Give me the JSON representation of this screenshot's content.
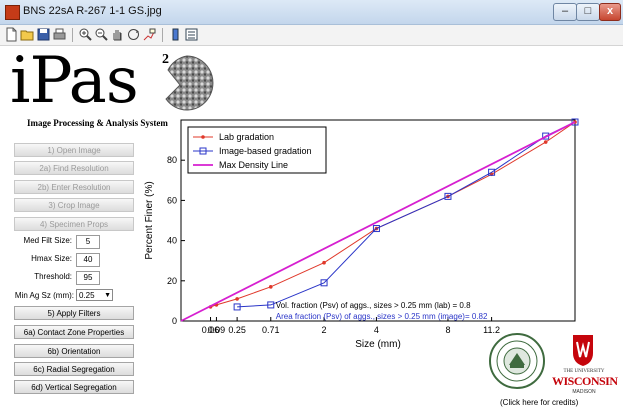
{
  "window": {
    "title": "BNS 22sA R-267 1-1 GS.jpg",
    "controls": {
      "minimize": "–",
      "maximize": "□",
      "close": "x"
    }
  },
  "toolbar": {
    "icons": [
      "new-file-icon",
      "open-folder-icon",
      "save-icon",
      "print-icon",
      "zoom-in-icon",
      "zoom-out-icon",
      "pan-hand-icon",
      "rotate-3d-icon",
      "data-cursor-icon",
      "colorbar-icon",
      "legend-icon"
    ]
  },
  "logo": {
    "text": "iPas",
    "superscript": "2"
  },
  "subtitle": "Image Processing & Analysis System",
  "steps": [
    {
      "label": "1) Open Image",
      "enabled": false
    },
    {
      "label": "2a) Find Resolution",
      "enabled": false
    },
    {
      "label": "2b) Enter Resolution",
      "enabled": false
    },
    {
      "label": "3) Crop Image",
      "enabled": false
    },
    {
      "label": "4) Specimen Props",
      "enabled": false
    }
  ],
  "params": {
    "med_filt_label": "Med Filt Size:",
    "med_filt_value": "5",
    "hmax_label": "Hmax Size:",
    "hmax_value": "40",
    "threshold_label": "Threshold:",
    "threshold_value": "95",
    "min_agg_label": "Min Ag Sz (mm):",
    "min_agg_value": "0.25"
  },
  "actions": {
    "apply_filters": "5) Apply Filters",
    "contact_zone": "6a) Contact Zone Properties",
    "orientation": "6b) Orientation",
    "radial_seg": "6c) Radial Segregation",
    "vertical_seg": "6d) Vertical Segregation"
  },
  "university": {
    "uw_small": "THE UNIVERSITY",
    "uw_name": "WISCONSIN",
    "uw_city": "MADISON"
  },
  "credits": "(Click here for credits)",
  "colors": {
    "lab": "#e0382a",
    "image": "#2a35c8",
    "maxdens": "#d61fd0"
  },
  "chart_data": {
    "type": "line",
    "xlabel": "Size (mm)",
    "ylabel": "Percent Finer (%)",
    "x_scale": "power-0.45",
    "xlim": [
      0,
      19
    ],
    "ylim": [
      0,
      100
    ],
    "x_ticks": [
      {
        "value": 0.06,
        "label": "0.06"
      },
      {
        "value": 0.09,
        "label": "0.09"
      },
      {
        "value": 0.25,
        "label": "0.25"
      },
      {
        "value": 0.71,
        "label": "0.71"
      },
      {
        "value": 2,
        "label": "2"
      },
      {
        "value": 4,
        "label": "4"
      },
      {
        "value": 8,
        "label": "8"
      },
      {
        "value": 11.2,
        "label": "11.2"
      }
    ],
    "y_ticks": [
      {
        "value": 0,
        "label": "0"
      },
      {
        "value": 20,
        "label": "20"
      },
      {
        "value": 40,
        "label": "40"
      },
      {
        "value": 60,
        "label": "60"
      },
      {
        "value": 80,
        "label": "80"
      }
    ],
    "legend_position": "top-left",
    "series": [
      {
        "name": "Lab gradation",
        "color": "#e0382a",
        "marker": "dot",
        "x": [
          0.06,
          0.09,
          0.25,
          0.71,
          2,
          4,
          8,
          11.2,
          16,
          19
        ],
        "y": [
          7,
          8,
          11,
          17,
          29,
          46,
          62,
          73,
          89,
          99
        ]
      },
      {
        "name": "Image-based gradation",
        "color": "#2a35c8",
        "marker": "square",
        "x": [
          0.25,
          0.71,
          2,
          4,
          8,
          11.2,
          16,
          19
        ],
        "y": [
          7,
          8,
          19,
          46,
          62,
          74,
          92,
          99
        ]
      },
      {
        "name": "Max Density Line",
        "color": "#d61fd0",
        "marker": "none",
        "x": [
          0,
          19
        ],
        "y": [
          0,
          99
        ]
      }
    ],
    "annotations": [
      {
        "text": "Vol. fraction (Psv) of aggs., sizes > 0.25 mm (lab) = 0.8",
        "color": "#000000"
      },
      {
        "text": "Area fraction (Psv) of aggs., sizes > 0.25 mm (image)= 0.82",
        "color": "#2a35c8"
      }
    ]
  }
}
